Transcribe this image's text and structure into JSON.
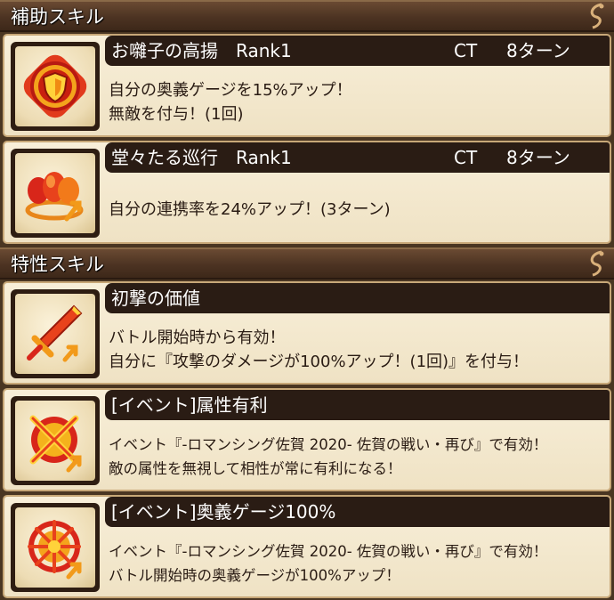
{
  "sections": {
    "support_title": "補助スキル",
    "trait_title": "特性スキル"
  },
  "support_skills": [
    {
      "name": "お囃子の高揚　Rank1",
      "ct_label": "CT",
      "ct_value": "8ターン",
      "icon": "shield-buff-icon",
      "lines": [
        "自分の奥義ゲージを15%アップ！",
        "無敵を付与！(1回)"
      ]
    },
    {
      "name": "堂々たる巡行　Rank1",
      "ct_label": "CT",
      "ct_value": "8ターン",
      "icon": "group-up-icon",
      "lines": [
        "自分の連携率を24%アップ！(3ターン)"
      ]
    }
  ],
  "trait_skills": [
    {
      "name": "初撃の価値",
      "icon": "sword-up-icon",
      "lines": [
        "バトル開始時から有効！",
        "自分に『攻撃のダメージが100%アップ！(1回)』を付与！"
      ]
    },
    {
      "name": "[イベント]属性有利",
      "icon": "element-advantage-icon",
      "lines": [
        "イベント『-ロマンシング佐賀 2020- 佐賀の戦い・再び』で有効！",
        "敵の属性を無視して相性が常に有利になる！"
      ]
    },
    {
      "name": "[イベント]奥義ゲージ100%",
      "icon": "special-gauge-icon",
      "lines": [
        "イベント『-ロマンシング佐賀 2020- 佐賀の戦い・再び』で有効！",
        "バトル開始時の奥義ゲージが100%アップ！"
      ]
    }
  ],
  "colors": {
    "header_bg": "#4c3322",
    "card_bg": "#f4e8cd",
    "title_bar_bg": "#2a1c14",
    "icon_red": "#d8261a",
    "icon_orange": "#f29a1a"
  }
}
